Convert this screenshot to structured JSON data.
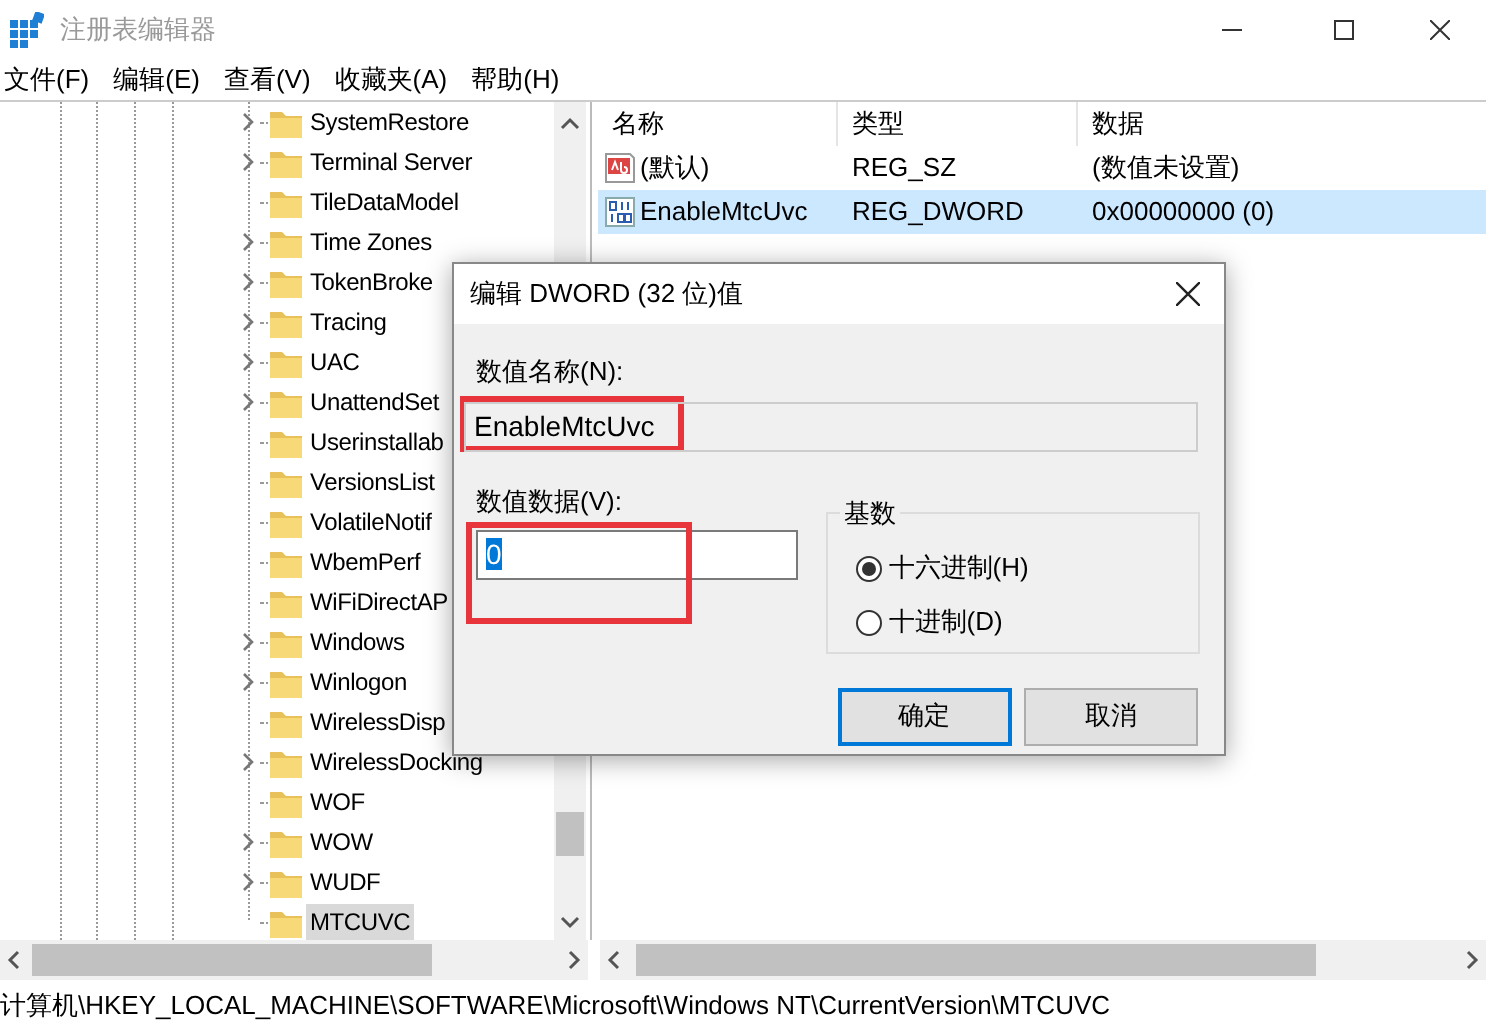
{
  "window": {
    "title": "注册表编辑器"
  },
  "menu": [
    "文件(F)",
    "编辑(E)",
    "查看(V)",
    "收藏夹(A)",
    "帮助(H)"
  ],
  "tree": {
    "items": [
      {
        "label": "SystemRestore",
        "expandable": true,
        "selected": false
      },
      {
        "label": "Terminal Server",
        "expandable": true,
        "selected": false
      },
      {
        "label": "TileDataModel",
        "expandable": false,
        "selected": false
      },
      {
        "label": "Time Zones",
        "expandable": true,
        "selected": false
      },
      {
        "label": "TokenBroke",
        "expandable": true,
        "selected": false
      },
      {
        "label": "Tracing",
        "expandable": true,
        "selected": false
      },
      {
        "label": "UAC",
        "expandable": true,
        "selected": false
      },
      {
        "label": "UnattendSet",
        "expandable": true,
        "selected": false
      },
      {
        "label": "Userinstallab",
        "expandable": false,
        "selected": false
      },
      {
        "label": "VersionsList",
        "expandable": false,
        "selected": false
      },
      {
        "label": "VolatileNotif",
        "expandable": false,
        "selected": false
      },
      {
        "label": "WbemPerf",
        "expandable": false,
        "selected": false
      },
      {
        "label": "WiFiDirectAP",
        "expandable": false,
        "selected": false
      },
      {
        "label": "Windows",
        "expandable": true,
        "selected": false
      },
      {
        "label": "Winlogon",
        "expandable": true,
        "selected": false
      },
      {
        "label": "WirelessDisp",
        "expandable": false,
        "selected": false
      },
      {
        "label": "WirelessDocking",
        "expandable": true,
        "selected": false
      },
      {
        "label": "WOF",
        "expandable": false,
        "selected": false
      },
      {
        "label": "WOW",
        "expandable": true,
        "selected": false
      },
      {
        "label": "WUDF",
        "expandable": true,
        "selected": false
      },
      {
        "label": "MTCUVC",
        "expandable": false,
        "selected": true
      }
    ]
  },
  "list": {
    "columns": [
      "名称",
      "类型",
      "数据"
    ],
    "rows": [
      {
        "kind": "string",
        "name": "(默认)",
        "type": "REG_SZ",
        "data": "(数值未设置)",
        "selected": false
      },
      {
        "kind": "dword",
        "name": "EnableMtcUvc",
        "type": "REG_DWORD",
        "data": "0x00000000 (0)",
        "selected": true
      }
    ]
  },
  "dialog": {
    "title": "编辑 DWORD (32 位)值",
    "name_label": "数值名称(N):",
    "name_value": "EnableMtcUvc",
    "name_highlighted": true,
    "data_label": "数值数据(V):",
    "data_value": "0",
    "data_highlighted": true,
    "base": {
      "label": "基数",
      "options": [
        {
          "label": "十六进制(H)",
          "selected": true
        },
        {
          "label": "十进制(D)",
          "selected": false
        }
      ]
    },
    "buttons": [
      {
        "label": "确定",
        "default": true
      },
      {
        "label": "取消",
        "default": false
      }
    ]
  },
  "status_bar": "计算机\\HKEY_LOCAL_MACHINE\\SOFTWARE\\Microsoft\\Windows NT\\CurrentVersion\\MTCUVC"
}
